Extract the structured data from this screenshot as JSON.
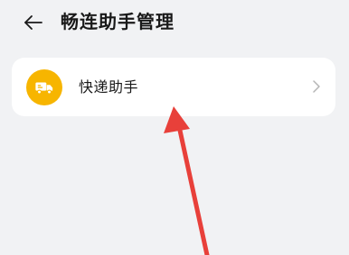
{
  "header": {
    "back_icon": "arrow-left-icon",
    "title": "畅连助手管理"
  },
  "list": {
    "items": [
      {
        "icon": "delivery-truck-icon",
        "icon_bg_color": "#f7b500",
        "label": "快递助手",
        "chevron_icon": "chevron-right-icon"
      }
    ]
  },
  "annotation": {
    "color": "#e8403a",
    "icon": "red-arrow-icon"
  },
  "colors": {
    "background": "#f1f2f4",
    "card": "#ffffff"
  }
}
